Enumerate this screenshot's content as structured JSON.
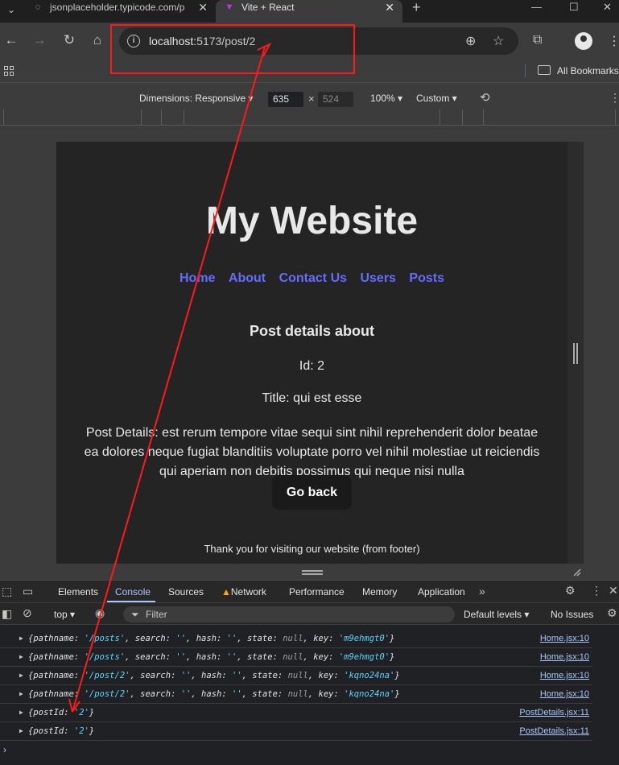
{
  "browser": {
    "tabs": [
      {
        "title": "jsonplaceholder.typicode.com/p",
        "active": false
      },
      {
        "title": "Vite + React",
        "active": true
      }
    ],
    "url_host": "localhost:",
    "url_path": "5173/post/2",
    "bookmarks_label": "All Bookmarks"
  },
  "device_toolbar": {
    "dimensions_label": "Dimensions: Responsive",
    "width": "635",
    "height": "524",
    "zoom": "100%",
    "throttle": "Custom"
  },
  "page": {
    "site_title": "My Website",
    "nav": [
      "Home",
      "About",
      "Contact Us",
      "Users",
      "Posts"
    ],
    "post_heading": "Post details about",
    "post_id": "Id: 2",
    "post_title": "Title: qui est esse",
    "post_body": "Post Details: est rerum tempore vitae sequi sint nihil reprehenderit dolor beatae ea dolores neque fugiat blanditiis voluptate porro vel nihil molestiae ut reiciendis qui aperiam non debitis possimus qui neque nisi nulla",
    "go_back": "Go back",
    "footer": "Thank you for visiting our website (from footer)"
  },
  "devtools": {
    "tabs": [
      "Elements",
      "Console",
      "Sources",
      "Network",
      "Performance",
      "Memory",
      "Application"
    ],
    "active_tab": "Console",
    "context": "top",
    "filter_placeholder": "Filter",
    "levels": "Default levels",
    "issues": "No Issues",
    "logs": [
      {
        "pathname": "'/posts'",
        "key": "'m9ehmgt0'",
        "source": "Home.jsx:10"
      },
      {
        "pathname": "'/posts'",
        "key": "'m9ehmgt0'",
        "source": "Home.jsx:10"
      },
      {
        "pathname": "'/post/2'",
        "key": "'kqno24na'",
        "source": "Home.jsx:10"
      },
      {
        "pathname": "'/post/2'",
        "key": "'kqno24na'",
        "source": "Home.jsx:10"
      },
      {
        "postId": "'2'",
        "source": "PostDetails.jsx:11"
      },
      {
        "postId": "'2'",
        "source": "PostDetails.jsx:11"
      }
    ]
  },
  "colors": {
    "accent_link": "#646cff",
    "annotation": "#ff1a1a",
    "console_string": "#5cd5fb"
  }
}
